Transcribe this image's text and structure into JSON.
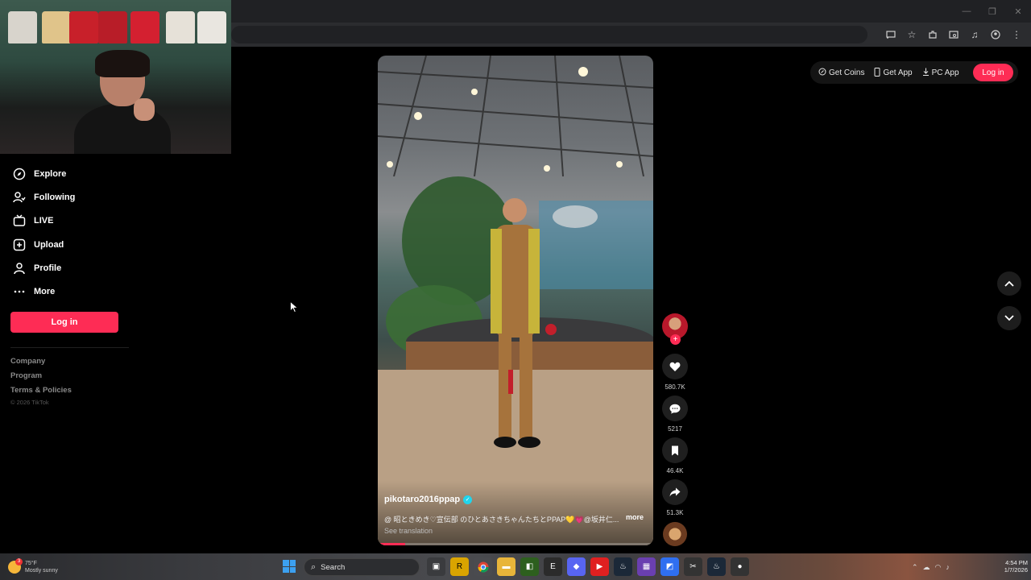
{
  "browser": {
    "window_controls": [
      "—",
      "❐",
      "✕"
    ],
    "toolbar_icons": [
      "cast-icon",
      "star-icon",
      "extensions-icon",
      "tab-search-icon",
      "media-icon",
      "profile-icon",
      "kebab-menu-icon"
    ]
  },
  "sidebar": {
    "items": [
      {
        "label": "Explore",
        "icon": "compass-icon"
      },
      {
        "label": "Following",
        "icon": "person-following-icon"
      },
      {
        "label": "LIVE",
        "icon": "live-tv-icon"
      },
      {
        "label": "Upload",
        "icon": "plus-square-icon"
      },
      {
        "label": "Profile",
        "icon": "person-icon"
      },
      {
        "label": "More",
        "icon": "ellipsis-icon"
      }
    ],
    "login_label": "Log in",
    "footer_links": [
      "Company",
      "Program",
      "Terms & Policies"
    ],
    "copyright": "© 2026 TikTok"
  },
  "header": {
    "get_coins": "Get Coins",
    "get_app": "Get App",
    "pc_app": "PC App",
    "login_label": "Log in"
  },
  "video": {
    "author": "pikotaro2016ppap",
    "description": "@ 昭ときめき♡宣伝部 のひとあさきちゃんたちとPPAP💛💗@坂井仁...",
    "more_label": "more",
    "see_translation": "See translation",
    "progress": 0.1
  },
  "actions": {
    "likes": "580.7K",
    "comments": "5217",
    "saves": "46.4K",
    "shares": "51.3K",
    "follow_plus": "+"
  },
  "taskbar": {
    "weather_temp": "75°F",
    "weather_cond": "Mostly sunny",
    "notification_badge": "3",
    "search_placeholder": "Search",
    "time": "4:54 PM",
    "date": "1/7/2026"
  },
  "colors": {
    "accent": "#fe2c55",
    "verified": "#20d5ec",
    "background": "#000000"
  }
}
